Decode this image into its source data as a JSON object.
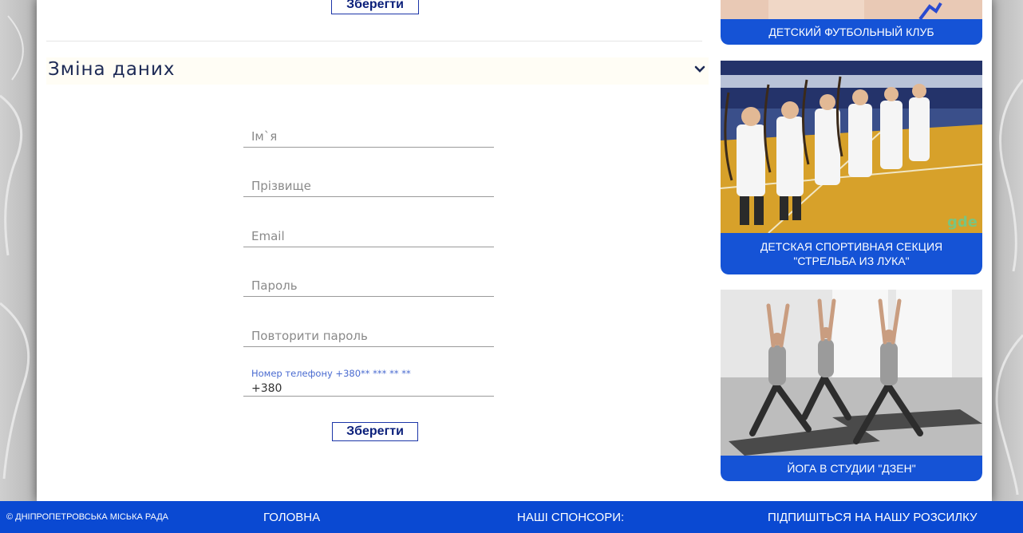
{
  "top": {
    "save_label": "Зберегти"
  },
  "section": {
    "title": "Зміна даних"
  },
  "form": {
    "name_placeholder": "Ім`я",
    "surname_placeholder": "Прізвище",
    "email_placeholder": "Email",
    "password_placeholder": "Пароль",
    "repeat_password_placeholder": "Повторити пароль",
    "phone_label": "Номер телефону +380** *** ** **",
    "phone_value": "+380",
    "save_label": "Зберегти"
  },
  "sidebar": {
    "cards": [
      {
        "caption": "ДЕТСКИЙ ФУТБОЛЬНЫЙ КЛУБ"
      },
      {
        "caption_line1": "ДЕТСКАЯ СПОРТИВНАЯ СЕКЦИЯ",
        "caption_line2": "\"СТРЕЛЬБА ИЗ ЛУКА\"",
        "watermark": "gde"
      },
      {
        "caption": "ЙОГА В СТУДИИ \"ДЗЕН\""
      }
    ]
  },
  "footer": {
    "copyright": "© ДНІПРОПЕТРОВСЬКА МІСЬКА РАДА",
    "home": "ГОЛОВНА",
    "sponsors": "НАШІ СПОНСОРИ:",
    "subscribe": "ПІДПИШІТЬСЯ НА НАШУ РОЗСИЛКУ"
  },
  "colors": {
    "accent_blue": "#1553d6",
    "footer_blue": "#0a49d2",
    "title_navy": "#1d2a55"
  }
}
